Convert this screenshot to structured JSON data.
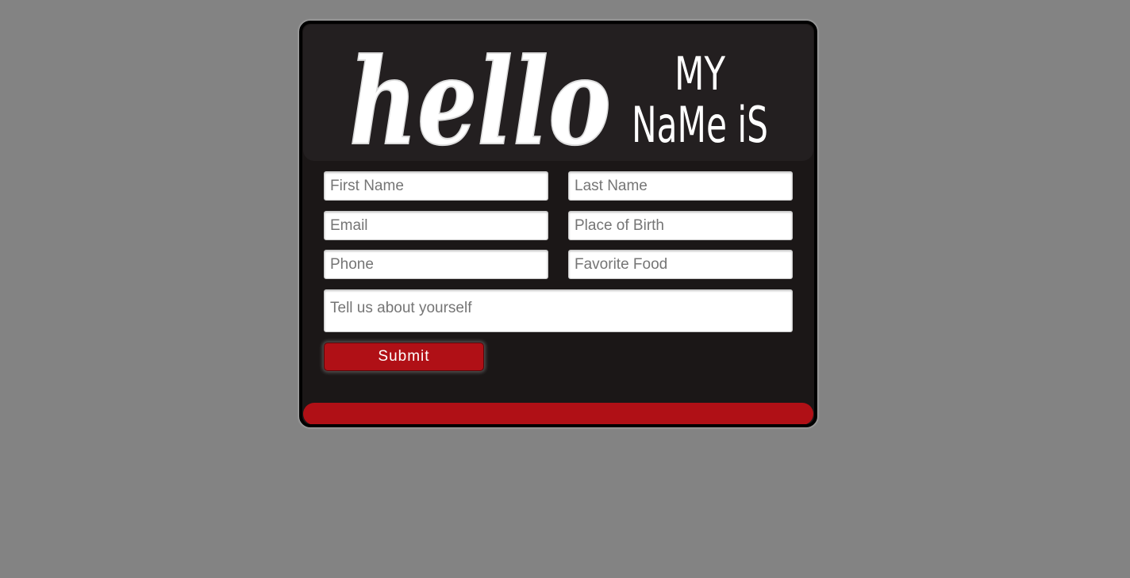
{
  "banner": {
    "logo_text_script": "hello",
    "logo_text_line1": "MY",
    "logo_text_line2": "NaMe iS"
  },
  "form": {
    "first_name_placeholder": "First Name",
    "last_name_placeholder": "Last Name",
    "email_placeholder": "Email",
    "place_of_birth_placeholder": "Place of Birth",
    "phone_placeholder": "Phone",
    "favorite_food_placeholder": "Favorite Food",
    "about_placeholder": "Tell us about yourself",
    "submit_label": "Submit"
  },
  "colors": {
    "page_background": "#838383",
    "card_background": "#1b1717",
    "accent_red": "#b01016"
  }
}
